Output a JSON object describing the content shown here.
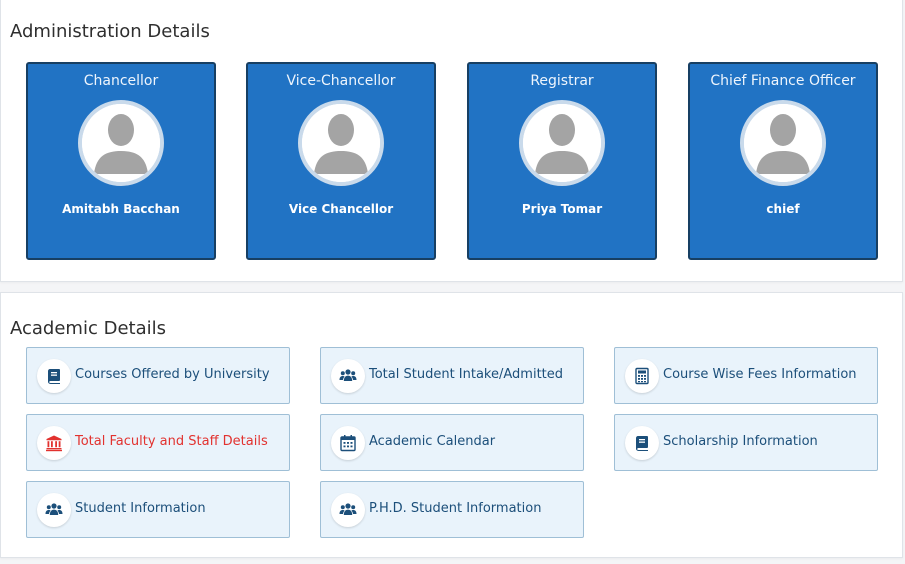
{
  "administration": {
    "title": "Administration Details",
    "cards": [
      {
        "role": "Chancellor",
        "name": "Amitabh Bacchan"
      },
      {
        "role": "Vice-Chancellor",
        "name": "Vice Chancellor"
      },
      {
        "role": "Registrar",
        "name": "Priya Tomar"
      },
      {
        "role": "Chief Finance Officer",
        "name": "chief"
      }
    ]
  },
  "academic": {
    "title": "Academic Details",
    "items": [
      {
        "label": "Courses Offered by University",
        "icon": "book-icon"
      },
      {
        "label": "Total Student Intake/Admitted",
        "icon": "users-icon"
      },
      {
        "label": "Course Wise Fees Information",
        "icon": "calculator-icon"
      },
      {
        "label": "Total Faculty and Staff Details",
        "icon": "institution-icon"
      },
      {
        "label": "Academic Calendar",
        "icon": "calendar-icon"
      },
      {
        "label": "Scholarship Information",
        "icon": "book-icon"
      },
      {
        "label": "Student Information",
        "icon": "users-icon"
      },
      {
        "label": "P.H.D. Student Information",
        "icon": "users-icon"
      }
    ]
  },
  "colors": {
    "card_blue": "#2173c4",
    "card_border": "#173f63",
    "tile_bg": "#e9f3fb",
    "link_text": "#1c4f7a",
    "alert_text": "#e2322f"
  }
}
